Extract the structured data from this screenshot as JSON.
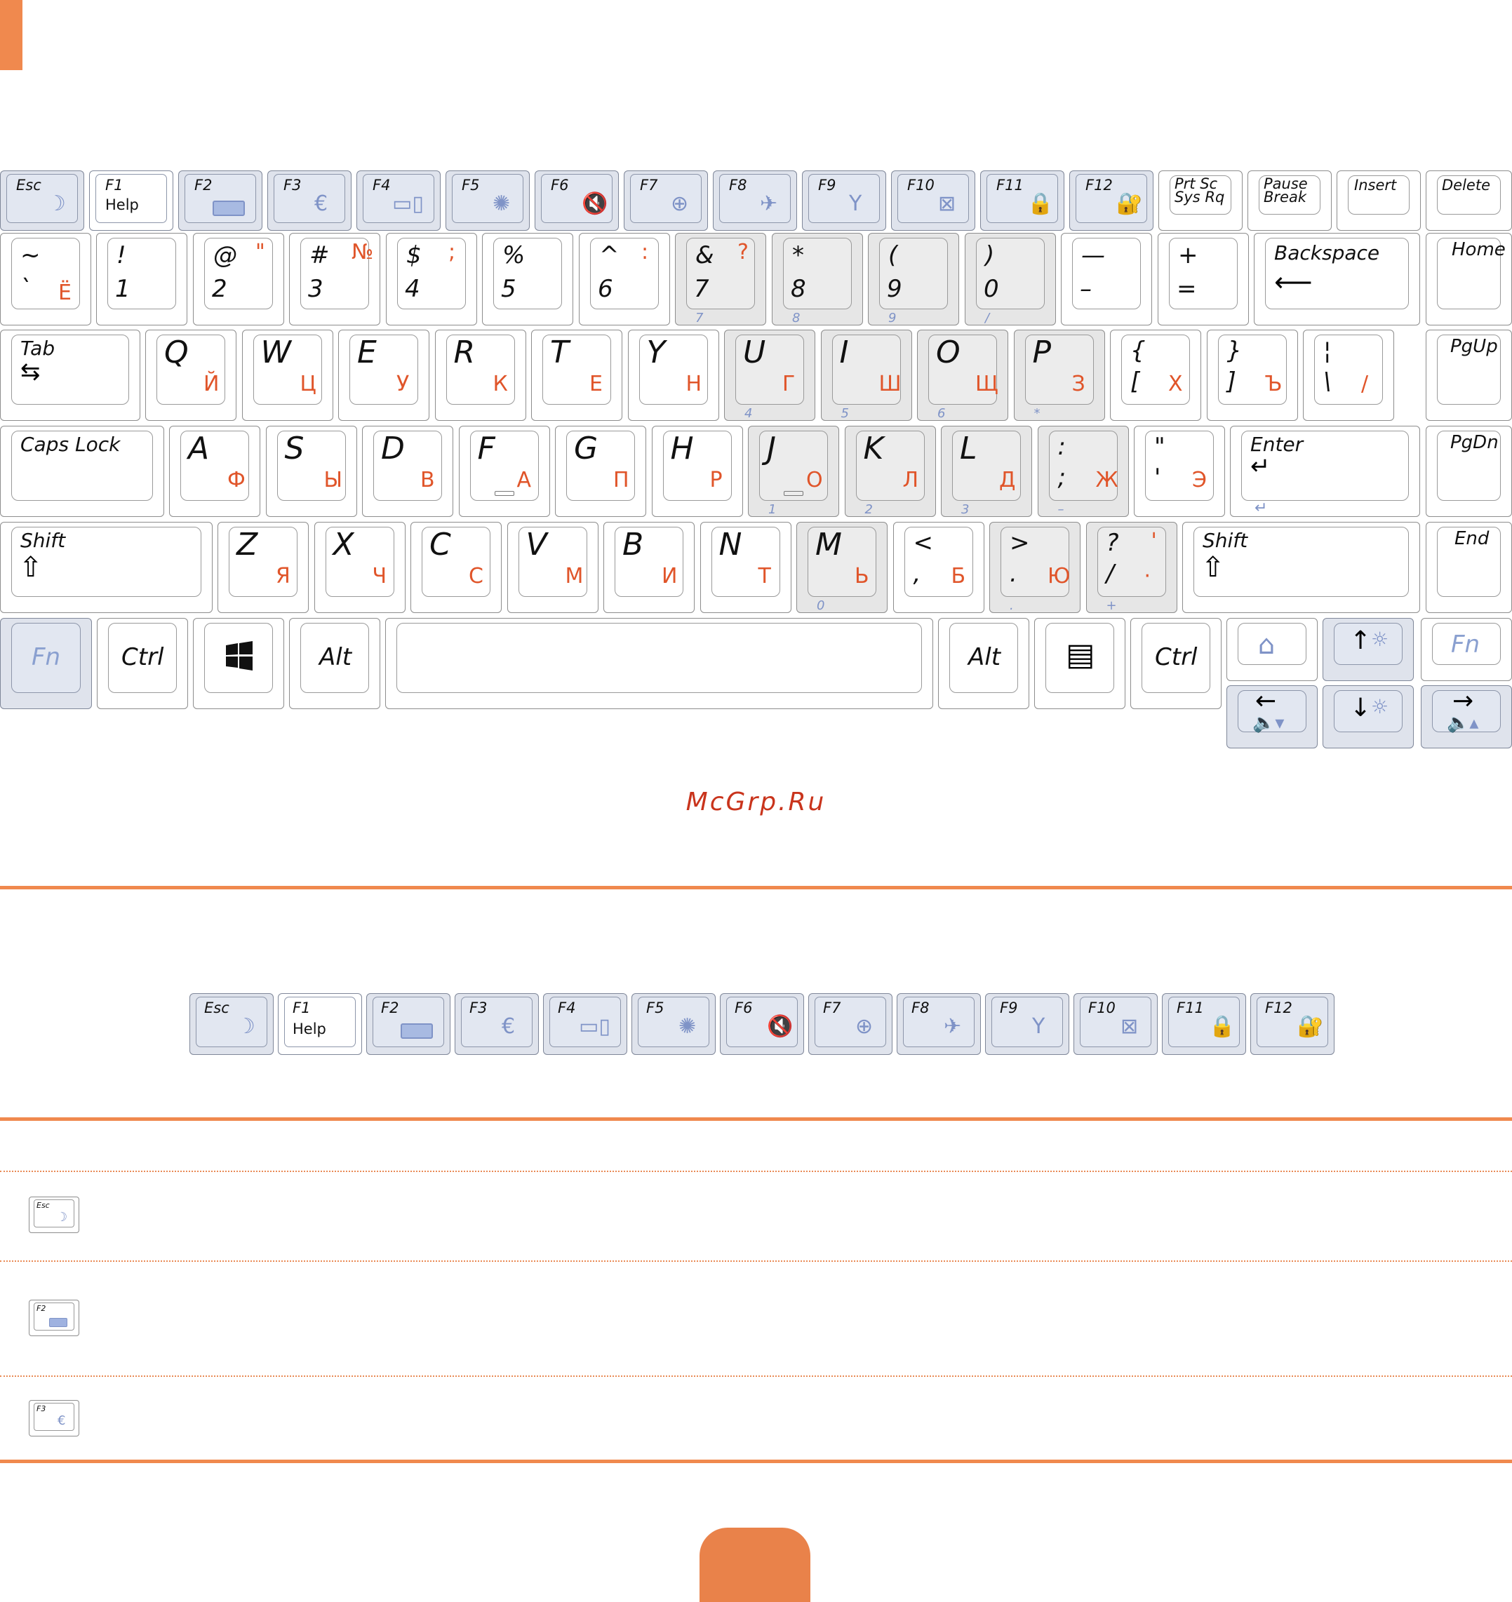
{
  "keyboard": {
    "fn_row": [
      "Esc",
      "F1",
      "F2",
      "F3",
      "F4",
      "F5",
      "F6",
      "F7",
      "F8",
      "F9",
      "F10",
      "F11",
      "F12"
    ],
    "f1_sub": "Help",
    "prtsc": [
      "Prt Sc",
      "Sys Rq"
    ],
    "pause": [
      "Pause",
      "Break"
    ],
    "insert": "Insert",
    "delete": "Delete",
    "home": "Home",
    "pgup": "PgUp",
    "pgdn": "PgDn",
    "end": "End",
    "backspace": "Backspace",
    "tab": "Tab",
    "caps_lock": "Caps Lock",
    "enter": "Enter",
    "shift": "Shift",
    "fn": "Fn",
    "ctrl": "Ctrl",
    "alt": "Alt",
    "number_row": [
      {
        "top": "~",
        "bottom": "`",
        "ru": "Ё",
        "ru_top": ""
      },
      {
        "top": "!",
        "bottom": "1",
        "ru": "",
        "ru_top": ""
      },
      {
        "top": "@",
        "bottom": "2",
        "ru": "",
        "ru_top": "\""
      },
      {
        "top": "#",
        "bottom": "3",
        "ru": "",
        "ru_top": "№"
      },
      {
        "top": "$",
        "bottom": "4",
        "ru": "",
        "ru_top": ";"
      },
      {
        "top": "%",
        "bottom": "5",
        "ru": "",
        "ru_top": ""
      },
      {
        "top": "^",
        "bottom": "6",
        "ru": "",
        "ru_top": ":"
      },
      {
        "top": "&",
        "bottom": "7",
        "ru": "",
        "ru_top": "?",
        "num": "7"
      },
      {
        "top": "*",
        "bottom": "8",
        "ru": "",
        "ru_top": "",
        "num": "8"
      },
      {
        "top": "(",
        "bottom": "9",
        "ru": "",
        "ru_top": "",
        "num": "9"
      },
      {
        "top": ")",
        "bottom": "0",
        "ru": "",
        "ru_top": "",
        "num": "/"
      },
      {
        "top": "—",
        "bottom": "–",
        "ru": "",
        "ru_top": ""
      },
      {
        "top": "+",
        "bottom": "=",
        "ru": "",
        "ru_top": ""
      }
    ],
    "row_q": [
      {
        "lat": "Q",
        "ru": "Й"
      },
      {
        "lat": "W",
        "ru": "Ц"
      },
      {
        "lat": "E",
        "ru": "У"
      },
      {
        "lat": "R",
        "ru": "К"
      },
      {
        "lat": "T",
        "ru": "Е"
      },
      {
        "lat": "Y",
        "ru": "Н"
      },
      {
        "lat": "U",
        "ru": "Г",
        "num": "4"
      },
      {
        "lat": "I",
        "ru": "Ш",
        "num": "5"
      },
      {
        "lat": "O",
        "ru": "Щ",
        "num": "6"
      },
      {
        "lat": "P",
        "ru": "З",
        "num": "*"
      },
      {
        "lat": "{",
        "lat2": "[",
        "ru": "Х"
      },
      {
        "lat": "}",
        "lat2": "]",
        "ru": "Ъ"
      },
      {
        "lat": "¦",
        "lat2": "\\",
        "ru": "/"
      }
    ],
    "row_a": [
      {
        "lat": "A",
        "ru": "Ф"
      },
      {
        "lat": "S",
        "ru": "Ы"
      },
      {
        "lat": "D",
        "ru": "В"
      },
      {
        "lat": "F",
        "ru": "А"
      },
      {
        "lat": "G",
        "ru": "П"
      },
      {
        "lat": "H",
        "ru": "Р"
      },
      {
        "lat": "J",
        "ru": "О",
        "num": "1"
      },
      {
        "lat": "K",
        "ru": "Л",
        "num": "2"
      },
      {
        "lat": "L",
        "ru": "Д",
        "num": "3"
      },
      {
        "lat": ":",
        "lat2": ";",
        "ru": "Ж",
        "num": "–"
      },
      {
        "lat": "\"",
        "lat2": "'",
        "ru": "Э"
      }
    ],
    "row_z": [
      {
        "lat": "Z",
        "ru": "Я"
      },
      {
        "lat": "X",
        "ru": "Ч"
      },
      {
        "lat": "C",
        "ru": "С"
      },
      {
        "lat": "V",
        "ru": "М"
      },
      {
        "lat": "B",
        "ru": "И"
      },
      {
        "lat": "N",
        "ru": "Т"
      },
      {
        "lat": "M",
        "ru": "Ь",
        "num": "0"
      },
      {
        "lat": "<",
        "lat2": ",",
        "ru": "Б"
      },
      {
        "lat": ">",
        "lat2": ".",
        "ru": "Ю",
        "num": "."
      },
      {
        "lat": "?",
        "lat2": "/",
        "ru": "·",
        "ru_top": "'",
        "num": "+"
      }
    ]
  },
  "watermark": "McGrp.Ru",
  "colors": {
    "accent": "#f0894e",
    "fn_blue": "#7f93c7",
    "ru_orange": "#e0552a"
  },
  "icons": [
    "moon-icon",
    "battery-icon",
    "euro-icon",
    "display-switch-icon",
    "brightness-icon",
    "mute-icon",
    "touchpad-icon",
    "runner-icon",
    "wireless-icon",
    "lcd-off-icon",
    "lock-icon",
    "security-lock-icon"
  ]
}
